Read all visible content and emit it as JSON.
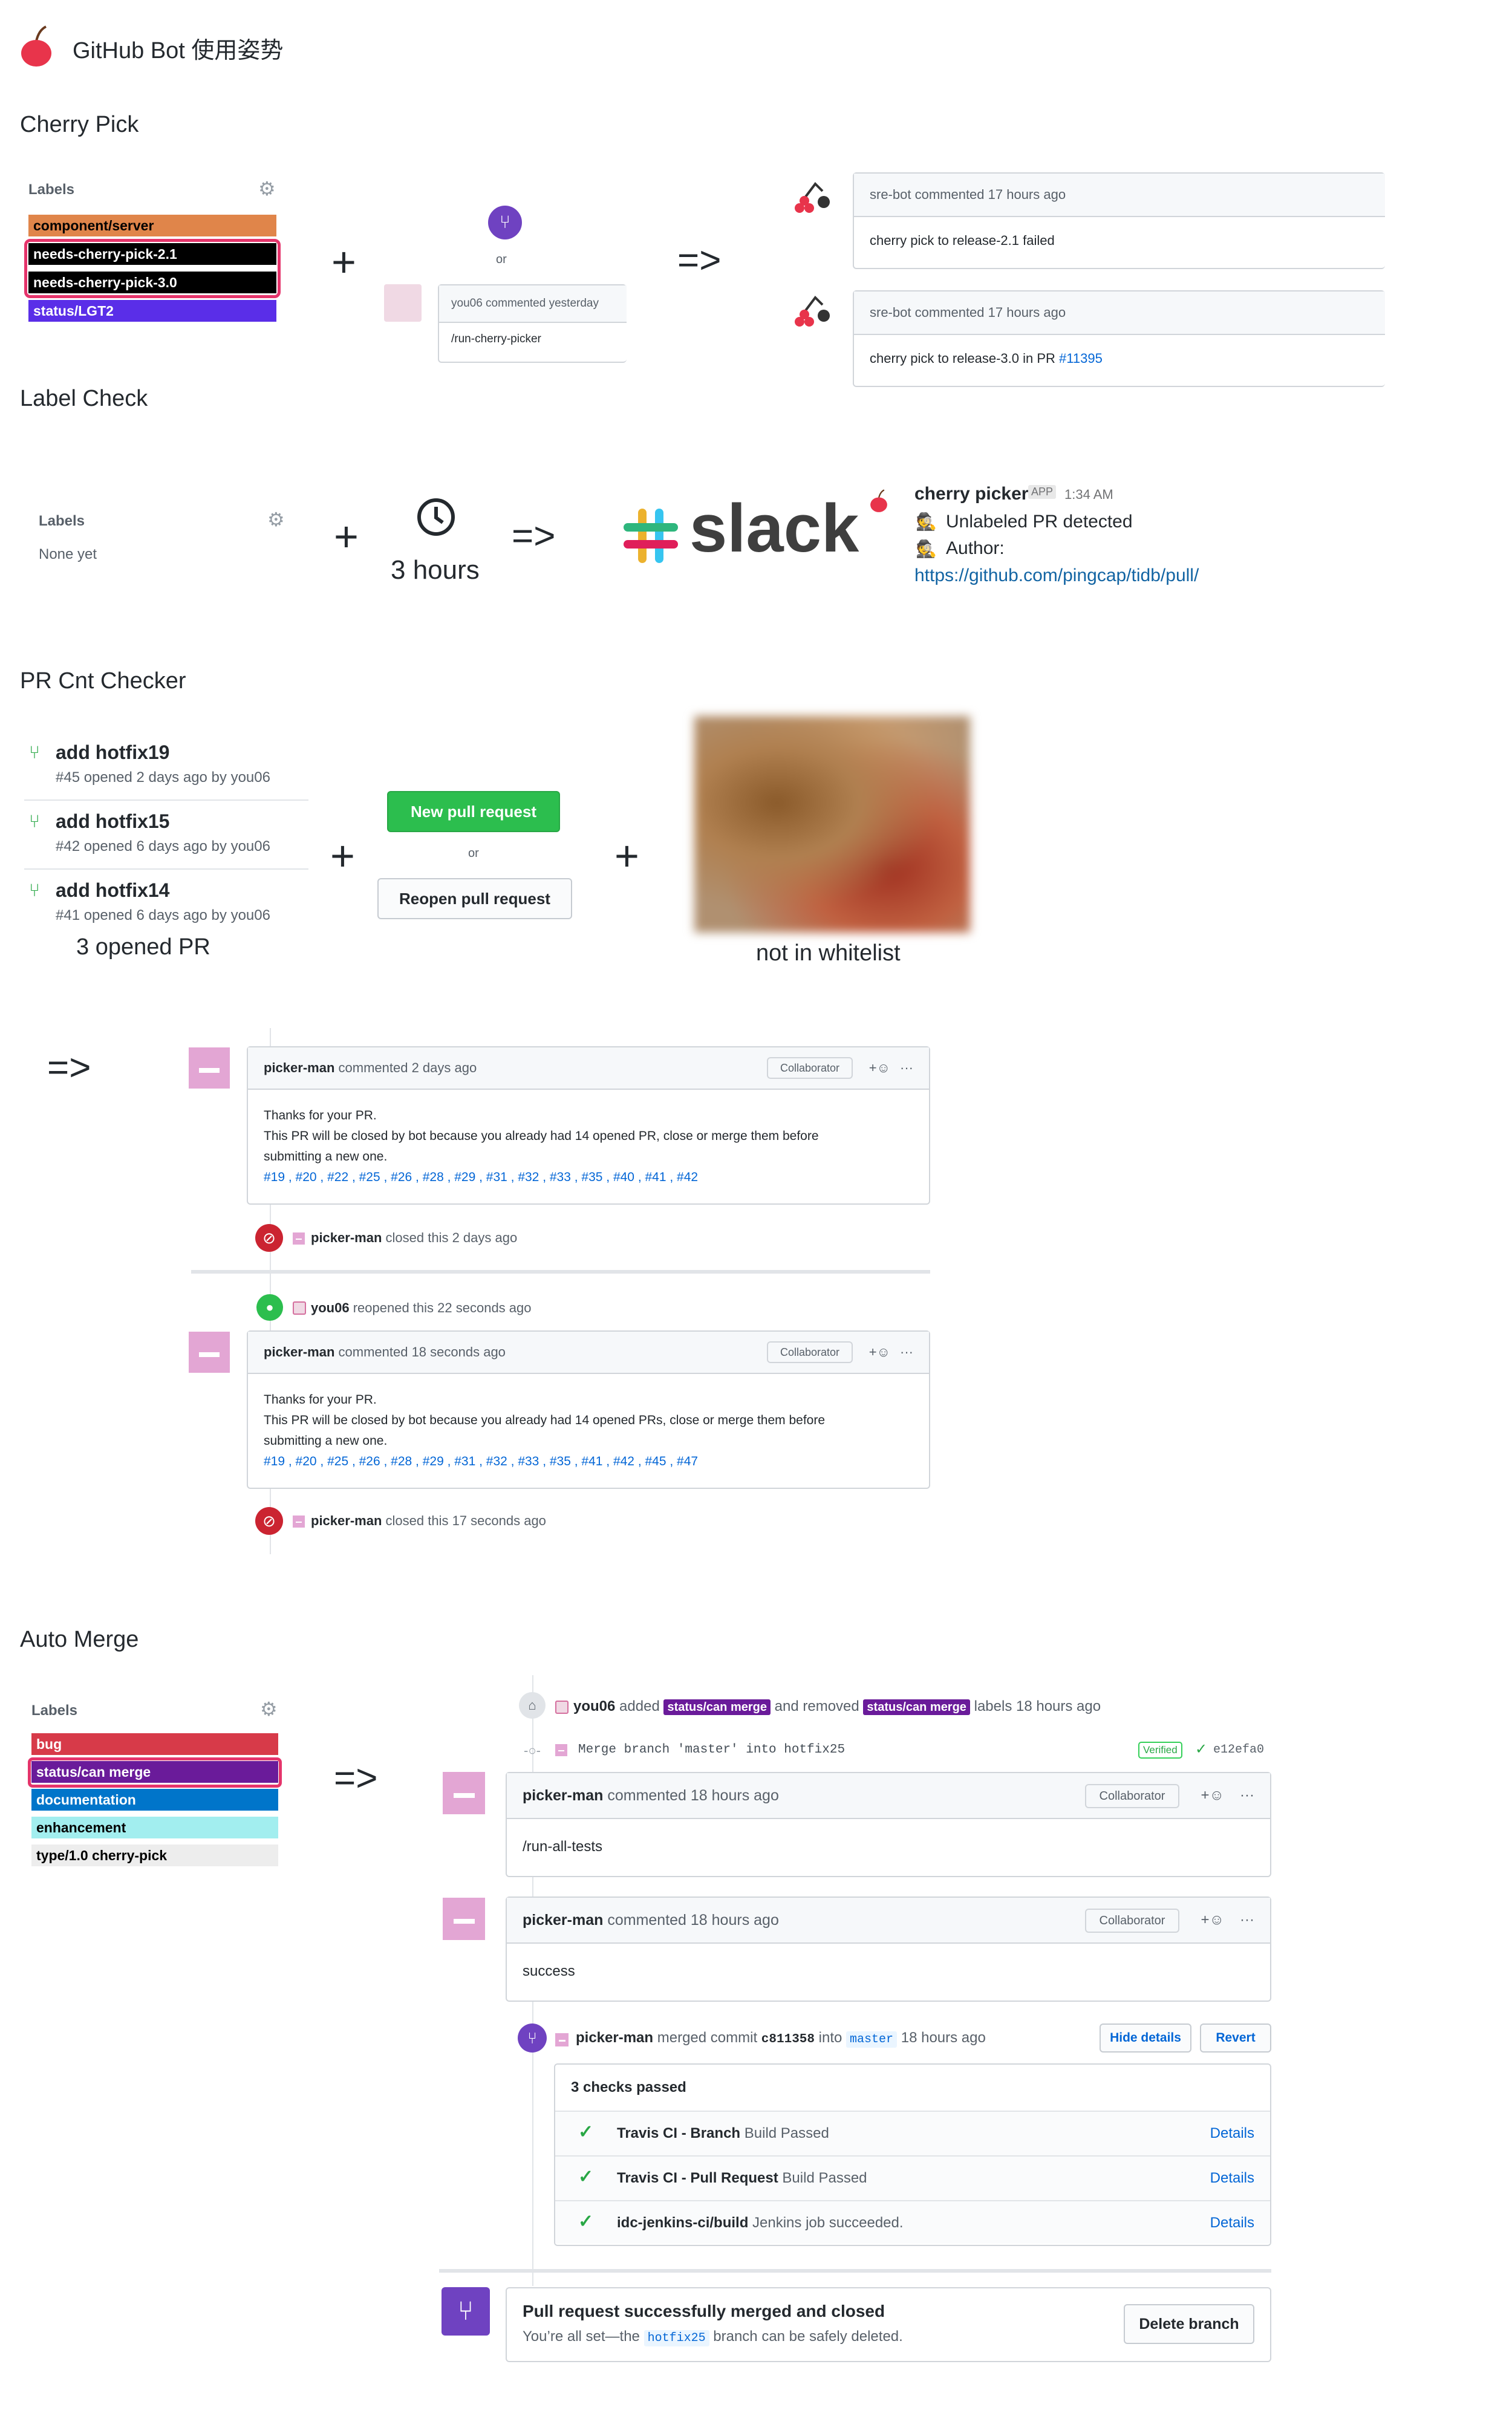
{
  "title": "GitHub Bot 使用姿势",
  "colors": {
    "orange": "#e0854a",
    "black": "#000000",
    "purple": "#5a2ee8",
    "red": "#d73a49",
    "merge": "#6f42c1",
    "green": "#2cbe4e",
    "highlight": "#e5346b"
  },
  "cp": {
    "heading": "Cherry Pick",
    "labels_title": "Labels",
    "labels": [
      "component/server",
      "needs-cherry-pick-2.1",
      "needs-cherry-pick-3.0",
      "status/LGT2"
    ],
    "or": "or",
    "comment_head": "you06 commented yesterday",
    "comment_body": "/run-cherry-picker",
    "plus": "+",
    "arrow": "=>",
    "bot1_head": "sre-bot commented 17 hours ago",
    "bot1_body": "cherry pick to release-2.1 failed",
    "bot2_head": "sre-bot commented 17 hours ago",
    "bot2_body": "cherry pick to release-3.0 in PR",
    "bot2_link": "#11395"
  },
  "lc": {
    "heading": "Label Check",
    "labels_title": "Labels",
    "none": "None yet",
    "plus": "+",
    "hours": "3 hours",
    "arrow": "=>",
    "slack": "slack",
    "bot": "cherry picker",
    "app": "APP",
    "time": "1:34 AM",
    "line1": "Unlabeled PR detected",
    "line2": "Author:",
    "url": "https://github.com/pingcap/tidb/pull/"
  },
  "pc": {
    "heading": "PR Cnt Checker",
    "prs": [
      {
        "title": "add hotfix19",
        "meta": "#45 opened 2 days ago by you06"
      },
      {
        "title": "add hotfix15",
        "meta": "#42 opened 6 days ago by you06"
      },
      {
        "title": "add hotfix14",
        "meta": "#41 opened 6 days ago by you06"
      }
    ],
    "opened": "3 opened PR",
    "plus": "+",
    "new_btn": "New pull request",
    "or": "or",
    "reopen_btn": "Reopen pull request",
    "plus2": "+",
    "whitelist": "not in whitelist",
    "arrow": "=>",
    "c1_author": "picker-man",
    "c1_time": "commented 2 days ago",
    "collab": "Collaborator",
    "more": "···",
    "react": "+☺",
    "c1_l1": "Thanks for your PR.",
    "c1_l2": "This PR will be closed by bot because you already had 14 opened PR, close or merge them before",
    "c1_l3": "submitting a new one.",
    "c1_links": "#19 , #20 , #22 , #25 , #26 , #28 , #29 , #31 , #32 , #33 , #35 , #40 , #41 , #42",
    "e1_author": "picker-man",
    "e1_text": "closed this 2 days ago",
    "e2_author": "you06",
    "e2_text": "reopened this 22 seconds ago",
    "c2_author": "picker-man",
    "c2_time": "commented 18 seconds ago",
    "c2_l1": "Thanks for your PR.",
    "c2_l2": "This PR will be closed by bot because you already had 14 opened PRs, close or merge them before",
    "c2_l3": "submitting a new one.",
    "c2_links": "#19 , #20 , #25 , #26 , #28 , #29 , #31 , #32 , #33 , #35 , #41 , #42 , #45 , #47",
    "e3_author": "picker-man",
    "e3_text": "closed this 17 seconds ago"
  },
  "am": {
    "heading": "Auto Merge",
    "labels_title": "Labels",
    "labels": [
      "bug",
      "status/can merge",
      "documentation",
      "enhancement",
      "type/1.0 cherry-pick"
    ],
    "arrow": "=>",
    "ev_author": "you06",
    "ev_added": "added",
    "ev_lbl1": "status/can merge",
    "ev_removed": "and removed",
    "ev_lbl2": "status/can merge",
    "ev_tail": "labels 18 hours ago",
    "commit_msg": "Merge branch 'master' into hotfix25",
    "verified": "Verified",
    "sha": "e12efa0",
    "c1_author": "picker-man",
    "c1_time": "commented 18 hours ago",
    "c1_body": "/run-all-tests",
    "c2_author": "picker-man",
    "c2_time": "commented 18 hours ago",
    "c2_body": "success",
    "collab": "Collaborator",
    "more": "···",
    "react": "+☺",
    "m_author": "picker-man",
    "m_text": "merged commit",
    "m_sha": "c811358",
    "m_into": "into",
    "m_branch": "master",
    "m_time": "18 hours ago",
    "hide": "Hide details",
    "revert": "Revert",
    "checks_title": "3 checks passed",
    "checks": [
      {
        "name": "Travis CI - Branch",
        "desc": "Build Passed",
        "link": "Details"
      },
      {
        "name": "Travis CI - Pull Request",
        "desc": "Build Passed",
        "link": "Details"
      },
      {
        "name": "idc-jenkins-ci/build",
        "desc": "Jenkins job succeeded.",
        "link": "Details"
      }
    ],
    "done_title": "Pull request successfully merged and closed",
    "done_pre": "You’re all set—the",
    "done_branch": "hotfix25",
    "done_post": "branch can be safely deleted.",
    "delete": "Delete branch"
  }
}
